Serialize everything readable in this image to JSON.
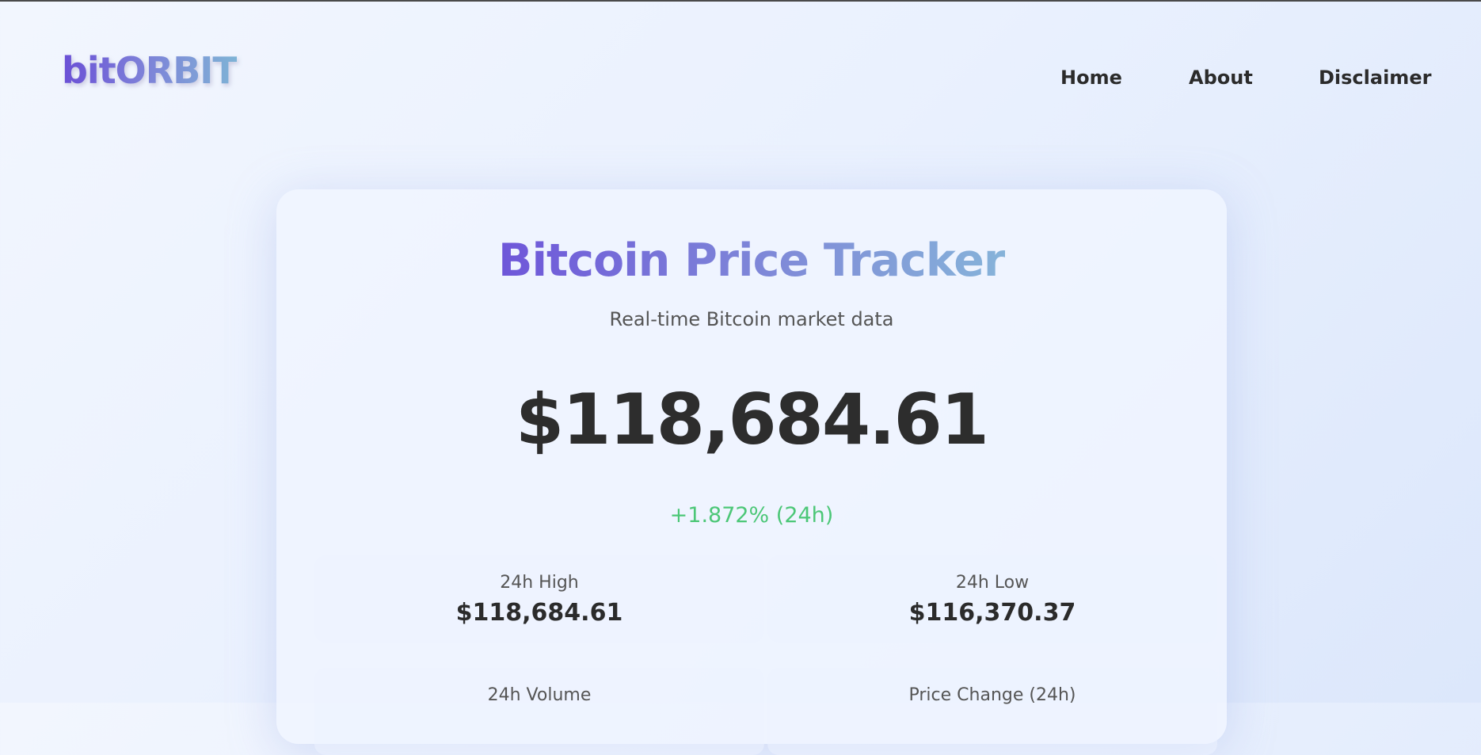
{
  "brand": {
    "logo_text": "bitORBIT"
  },
  "nav": {
    "home": "Home",
    "about": "About",
    "disclaimer": "Disclaimer"
  },
  "tracker": {
    "title": "Bitcoin Price Tracker",
    "subtitle": "Real-time Bitcoin market data",
    "price": "$118,684.61",
    "change": "+1.872% (24h)",
    "stats": {
      "high": {
        "label": "24h High",
        "value": "$118,684.61"
      },
      "low": {
        "label": "24h Low",
        "value": "$116,370.37"
      },
      "volume": {
        "label": "24h Volume"
      },
      "price_change": {
        "label": "Price Change (24h)"
      }
    }
  },
  "colors": {
    "positive_change": "#4cc777",
    "brand_gradient_start": "#6a4fd6",
    "brand_gradient_end": "#7eb3d6",
    "text_dark": "#2d2d2d"
  }
}
